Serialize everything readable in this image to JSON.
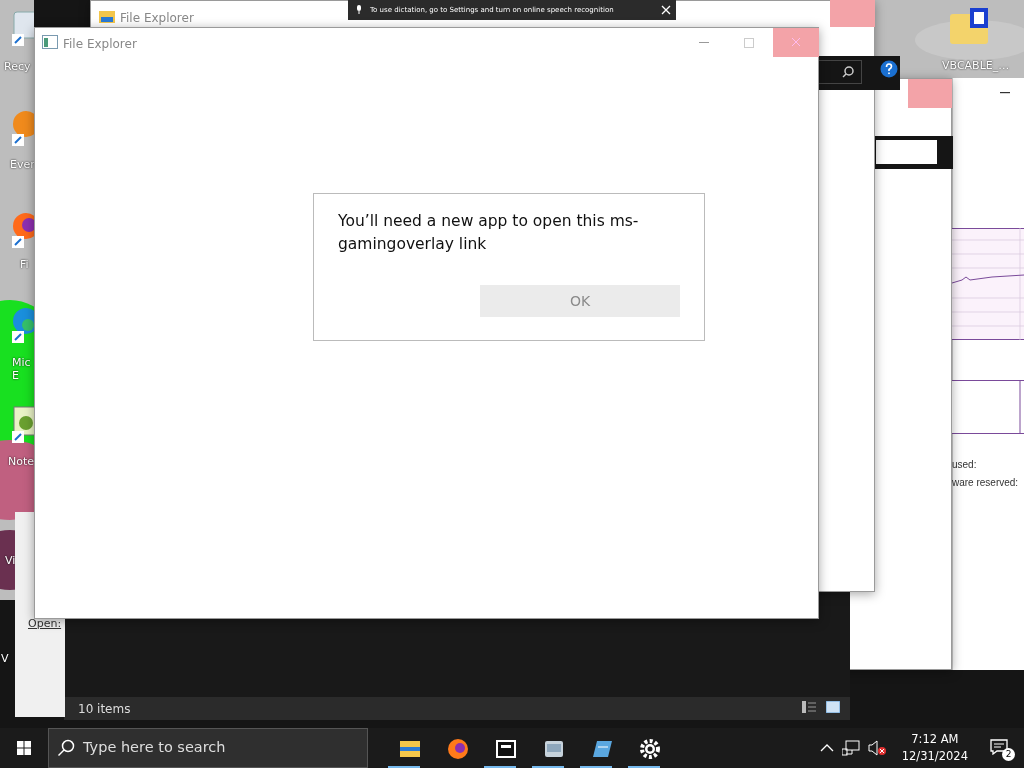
{
  "desktop_icons": [
    {
      "kind": "recycle",
      "lines": [
        "Recy"
      ]
    },
    {
      "kind": "orange",
      "lines": [
        "Ever"
      ]
    },
    {
      "kind": "firefox",
      "lines": [
        "Fi"
      ]
    },
    {
      "kind": "edge",
      "lines": [
        "Mic",
        "E"
      ]
    },
    {
      "kind": "notepad",
      "lines": [
        "Note"
      ]
    },
    {
      "kind": "blank",
      "lines": [
        "Vi"
      ]
    },
    {
      "kind": "blank",
      "lines": [
        "V"
      ]
    },
    {
      "kind": "folder",
      "lines": [
        "VBCABLE_…"
      ]
    }
  ],
  "dictation_toast": {
    "text": "To use dictation, go to Settings and turn on online speech recognition"
  },
  "back_explorer": {
    "title": "File Explorer"
  },
  "dark_explorer": {
    "status": "10 items"
  },
  "run_dialog": {
    "label": "Open:"
  },
  "memory_window": {
    "labels": [
      "used:",
      "ware reserved:"
    ]
  },
  "main_window": {
    "title": "File Explorer",
    "dialog": {
      "message": "You’ll need a new app to open this ms-gamingoverlay link",
      "button": {
        "label": "OK",
        "disabled": true
      }
    }
  },
  "taskbar": {
    "search": {
      "placeholder": "Type here to search"
    },
    "apps": [
      {
        "kind": "folder",
        "running": true
      },
      {
        "kind": "firefox",
        "running": false
      },
      {
        "kind": "sevenzip",
        "running": true
      },
      {
        "kind": "app",
        "running": true
      },
      {
        "kind": "window",
        "running": true
      },
      {
        "kind": "gear",
        "running": true
      }
    ],
    "time": "7:12 AM",
    "date": "12/31/2024",
    "notifications": "2"
  }
}
